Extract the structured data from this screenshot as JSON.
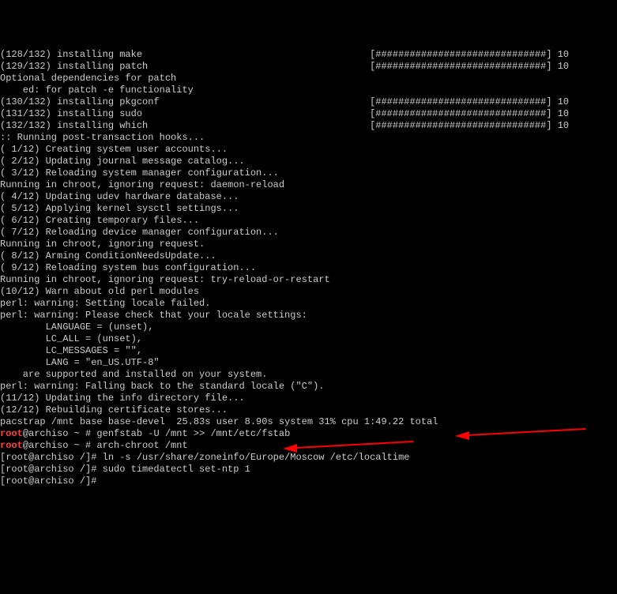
{
  "lines": [
    {
      "left": "(128/132) installing make",
      "bar": true
    },
    {
      "left": "(129/132) installing patch",
      "bar": true
    },
    {
      "left": "Optional dependencies for patch"
    },
    {
      "left": "    ed: for patch -e functionality"
    },
    {
      "left": "(130/132) installing pkgconf",
      "bar": true
    },
    {
      "left": "(131/132) installing sudo",
      "bar": true
    },
    {
      "left": "(132/132) installing which",
      "bar": true
    },
    {
      "left": ":: Running post-transaction hooks..."
    },
    {
      "left": "( 1/12) Creating system user accounts..."
    },
    {
      "left": "( 2/12) Updating journal message catalog..."
    },
    {
      "left": "( 3/12) Reloading system manager configuration..."
    },
    {
      "left": "Running in chroot, ignoring request: daemon-reload"
    },
    {
      "left": "( 4/12) Updating udev hardware database..."
    },
    {
      "left": "( 5/12) Applying kernel sysctl settings..."
    },
    {
      "left": "( 6/12) Creating temporary files..."
    },
    {
      "left": "( 7/12) Reloading device manager configuration..."
    },
    {
      "left": "Running in chroot, ignoring request."
    },
    {
      "left": "( 8/12) Arming ConditionNeedsUpdate..."
    },
    {
      "left": "( 9/12) Reloading system bus configuration..."
    },
    {
      "left": "Running in chroot, ignoring request: try-reload-or-restart"
    },
    {
      "left": "(10/12) Warn about old perl modules"
    },
    {
      "left": "perl: warning: Setting locale failed."
    },
    {
      "left": "perl: warning: Please check that your locale settings:"
    },
    {
      "left": "        LANGUAGE = (unset),"
    },
    {
      "left": "        LC_ALL = (unset),"
    },
    {
      "left": "        LC_MESSAGES = \"\","
    },
    {
      "left": "        LANG = \"en_US.UTF-8\""
    },
    {
      "left": "    are supported and installed on your system."
    },
    {
      "left": "perl: warning: Falling back to the standard locale (\"C\")."
    },
    {
      "left": "(11/12) Updating the info directory file..."
    },
    {
      "left": "(12/12) Rebuilding certificate stores..."
    },
    {
      "left": "pacstrap /mnt base base-devel  25.83s user 8.90s system 31% cpu 1:49.22 total"
    },
    {
      "prompt_red": "root",
      "prompt_rest": "@archiso ~ # ",
      "cmd": "genfstab -U /mnt >> /mnt/etc/fstab"
    },
    {
      "prompt_red": "root",
      "prompt_rest": "@archiso ~ # ",
      "cmd": "arch-chroot /mnt"
    },
    {
      "left": "[root@archiso /]# ",
      "cmd2": "ln -s /usr/share/zoneinfo/Europe/Moscow /etc/localtime"
    },
    {
      "left": "[root@archiso /]# ",
      "cmd2": "sudo timedatectl set-ntp 1"
    },
    {
      "left": "[root@archiso /]# "
    }
  ],
  "progress_bar": "[##############################] 10",
  "bar_col": 65
}
